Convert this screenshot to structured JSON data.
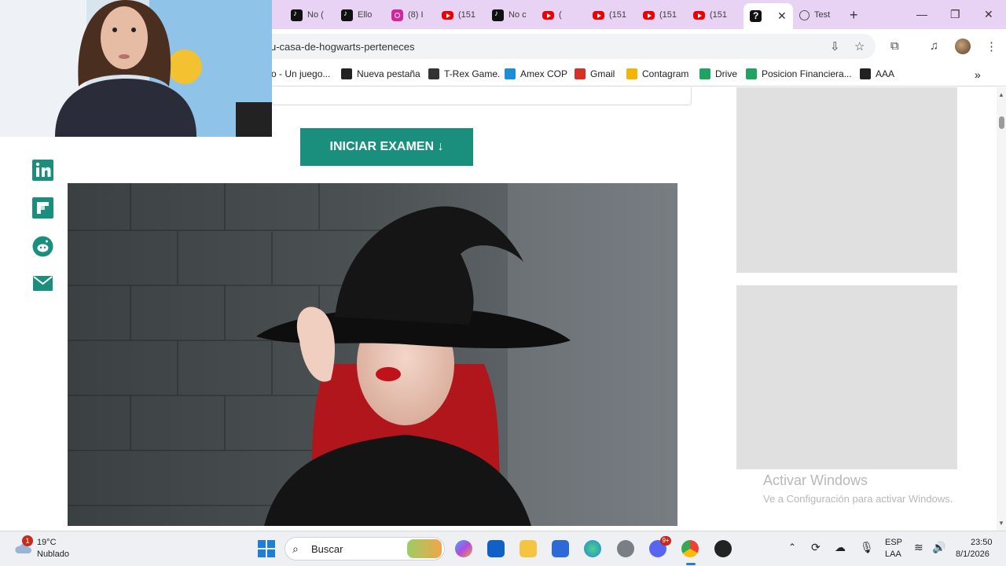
{
  "tabs": [
    {
      "type": "tiktok",
      "label": "No ("
    },
    {
      "type": "tiktok",
      "label": "Ello"
    },
    {
      "type": "insta",
      "label": "(8) I"
    },
    {
      "type": "yt",
      "label": "(151"
    },
    {
      "type": "tiktok",
      "label": "No c"
    },
    {
      "type": "yt",
      "label": "("
    },
    {
      "type": "yt",
      "label": "(151"
    },
    {
      "type": "yt",
      "label": "(151"
    },
    {
      "type": "yt",
      "label": "(151"
    }
  ],
  "active_tab": {
    "close": "✕"
  },
  "other_tab": {
    "label": "Test"
  },
  "address_bar": {
    "url": "u-casa-de-hogwarts-perteneces"
  },
  "bookmarks": [
    {
      "label": "o - Un juego...",
      "icon": "game-icon",
      "color": "#f4b400"
    },
    {
      "label": "Nueva pestaña",
      "icon": "globe-icon",
      "color": "#222222"
    },
    {
      "label": "T-Rex Game.",
      "icon": "dino-icon",
      "color": "#333333"
    },
    {
      "label": "Amex COP",
      "icon": "amex-icon",
      "color": "#1a8fd8"
    },
    {
      "label": "Gmail",
      "icon": "gmail-icon",
      "color": "#d93025"
    },
    {
      "label": "Contagram",
      "icon": "contagram-icon",
      "color": "#f4b400"
    },
    {
      "label": "Drive",
      "icon": "drive-icon",
      "color": "#1ea362"
    },
    {
      "label": "Posicion Financiera...",
      "icon": "drive-icon",
      "color": "#1ea362"
    },
    {
      "label": "AAA",
      "icon": "triangle-icon",
      "color": "#222222"
    }
  ],
  "page": {
    "cta_label": "INICIAR EXAMEN ↓",
    "social_icons": [
      "linkedin-icon",
      "flipboard-icon",
      "reddit-icon",
      "email-icon"
    ]
  },
  "watermark": {
    "title": "Activar Windows",
    "subtitle": "Ve a Configuración para activar Windows."
  },
  "taskbar": {
    "temperature": "19°C",
    "weather": "Nublado",
    "weather_badge": "1",
    "search_placeholder": "Buscar",
    "language": "ESP",
    "layout": "LAA",
    "time": "23:50",
    "date": "8/1/2026",
    "discord_badge": "9+"
  },
  "colors": {
    "accent": "#1a8f7d",
    "tabstrip": "#e8d3f5",
    "social": "#1a8f7d"
  }
}
